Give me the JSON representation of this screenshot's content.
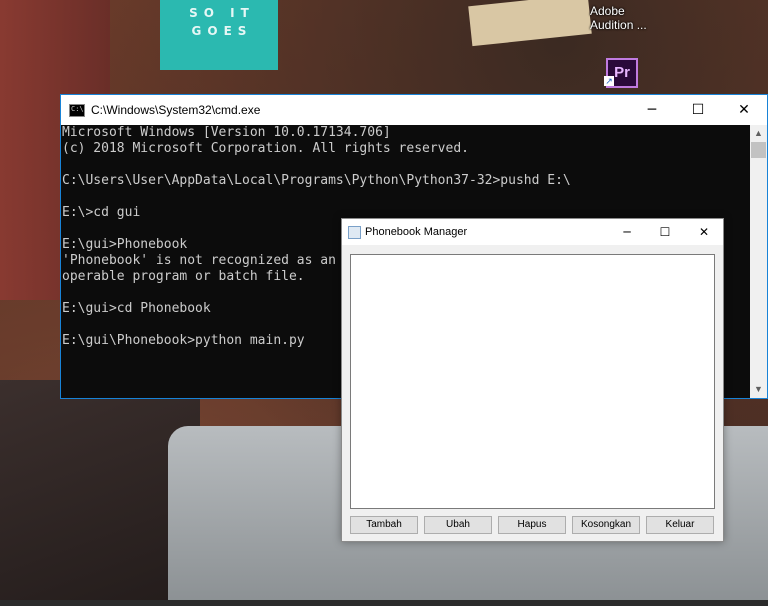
{
  "desktop": {
    "poster_text": "SO IT GOES",
    "icons": [
      {
        "label": "Adobe Audition ...",
        "icon": "audition-icon"
      },
      {
        "label": "Pr",
        "icon": "premiere-pro-icon"
      }
    ]
  },
  "cmd": {
    "title": "C:\\Windows\\System32\\cmd.exe",
    "lines": [
      "Microsoft Windows [Version 10.0.17134.706]",
      "(c) 2018 Microsoft Corporation. All rights reserved.",
      "",
      "C:\\Users\\User\\AppData\\Local\\Programs\\Python\\Python37-32>pushd E:\\",
      "",
      "E:\\>cd gui",
      "",
      "E:\\gui>Phonebook",
      "'Phonebook' is not recognized as an internal or external command,",
      "operable program or batch file.",
      "",
      "E:\\gui>cd Phonebook",
      "",
      "E:\\gui\\Phonebook>python main.py"
    ],
    "controls": {
      "minimize": "─",
      "maximize": "☐",
      "close": "✕"
    },
    "scroll": {
      "up": "▲",
      "down": "▼"
    }
  },
  "phonebook": {
    "title": "Phonebook Manager",
    "controls": {
      "minimize": "─",
      "maximize": "☐",
      "close": "✕"
    },
    "buttons": [
      "Tambah",
      "Ubah",
      "Hapus",
      "Kosongkan",
      "Keluar"
    ]
  },
  "colors": {
    "window_border": "#1883d7",
    "console_bg": "#0c0c0c",
    "console_text": "#cccccc"
  }
}
